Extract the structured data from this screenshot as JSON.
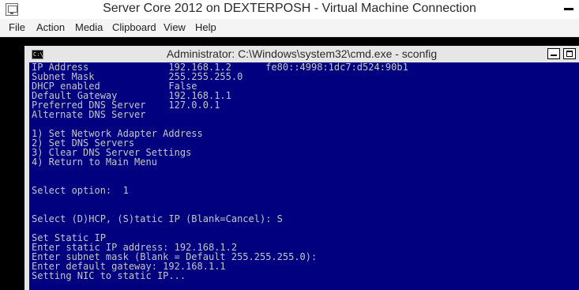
{
  "vm_window": {
    "title": "Server Core 2012 on DEXTERPOSH - Virtual Machine Connection",
    "menu": [
      "File",
      "Action",
      "Media",
      "Clipboard",
      "View",
      "Help"
    ]
  },
  "cmd_window": {
    "title": "Administrator: C:\\Windows\\system32\\cmd.exe - sconfig",
    "icon_glyph": "C:\\"
  },
  "console_lines": [
    "IP Address              192.168.1.2      fe80::4998:1dc7:d524:90b1",
    "Subnet Mask             255.255.255.0",
    "DHCP enabled            False",
    "Default Gateway         192.168.1.1",
    "Preferred DNS Server    127.0.0.1",
    "Alternate DNS Server",
    "",
    "1) Set Network Adapter Address",
    "2) Set DNS Servers",
    "3) Clear DNS Server Settings",
    "4) Return to Main Menu",
    "",
    "",
    "Select option:  1",
    "",
    "",
    "Select (D)HCP, (S)tatic IP (Blank=Cancel): S",
    "",
    "Set Static IP",
    "Enter static IP address: 192.168.1.2",
    "Enter subnet mask (Blank = Default 255.255.255.0):",
    "Enter default gateway: 192.168.1.1",
    "Setting NIC to static IP..."
  ],
  "colors": {
    "console_background": "#01017f",
    "console_text": "#c6c6c6",
    "titlebar_background": "#ffffff",
    "menubar_background": "#f4f4f4"
  }
}
